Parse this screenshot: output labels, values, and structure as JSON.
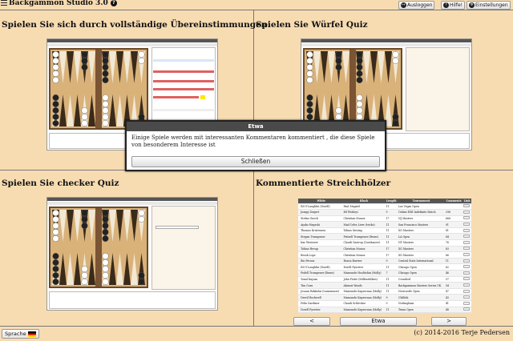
{
  "header": {
    "app_title": "Backgammon Studio 3.0",
    "buttons": [
      {
        "label": "Ausloggen",
        "icon": "logout-icon"
      },
      {
        "label": "Hilfe!",
        "icon": "help-icon"
      },
      {
        "label": "Einstellungen",
        "icon": "gear-icon"
      }
    ]
  },
  "quadrants": {
    "top_left_title": "Spielen Sie sich durch vollständige Übereinstimmungen",
    "top_right_title": "Spielen Sie Würfel Quiz",
    "bottom_left_title": "Spielen Sie checker Quiz",
    "bottom_right_title": "Kommentierte Streichhölzer"
  },
  "matches_table": {
    "headers": [
      "",
      "White",
      "Black",
      "Length",
      "Tournament",
      "Comments",
      "Link"
    ],
    "rows": [
      [
        "Ed O'Laughlin (Dorell)",
        "Paul Magriel",
        "11",
        "Las Vegas Open",
        "",
        ""
      ],
      [
        "Jumpy Ziegert",
        "Ed Wesleys",
        "9",
        "Online ESR Indefinite Match",
        "296",
        ""
      ],
      [
        "Stefan Gueck",
        "Christian Munoz",
        "17",
        "NJ Masters",
        "666",
        ""
      ],
      [
        "Ayako Hayashi",
        "Mad Celes Liver (tricks)",
        "11",
        "San Francisco Masters",
        "91",
        ""
      ],
      [
        "Thomas Kristensen",
        "Tobias Siesing",
        "11",
        "XG Masters",
        "81",
        ""
      ],
      [
        "Stepan Trumpener",
        "Fritzell Trumpener (Bears)",
        "11",
        "LA Open",
        "84",
        ""
      ],
      [
        "Kar Westover",
        "Claudi Gastrop (Quickmove)",
        "11",
        "NY Masters",
        "76",
        ""
      ],
      [
        "Tobias Hevap",
        "Christian Munoz",
        "17",
        "XG Masters",
        "83",
        ""
      ],
      [
        "Brook Lops",
        "Christian Munoz",
        "17",
        "XG Masters",
        "86",
        ""
      ],
      [
        "Bio Person",
        "Ronca Burrier",
        "9",
        "Central Stats International",
        "11",
        ""
      ],
      [
        "Ed O'Laughlin (Dorell)",
        "Dorell Pyerster",
        "11",
        "Chicago Open",
        "82",
        ""
      ],
      [
        "Fedell Trumpener (Bears)",
        "Mazounde Hoolitshin (Molly)",
        "7",
        "Chicago Open",
        "46",
        ""
      ],
      [
        "Yonal Kayam",
        "John Fisler (Millendollars)",
        "11",
        "Crossbed",
        "57",
        ""
      ],
      [
        "Tim Gora",
        "Akinori Woods",
        "11",
        "Backgammon Masters Series UK",
        "54",
        ""
      ],
      [
        "Josuan Rakkolai (Lunamouse)",
        "Mazounde Kaprovana (Molly)",
        "11",
        "Newcastle Open",
        "47",
        ""
      ],
      [
        "Drevil Rockwell",
        "Mazounde Kaprovana (Molly)",
        "9",
        "Chillick",
        "43",
        ""
      ],
      [
        "Felix Gardiner",
        "Claudi Schlecker",
        "9",
        "Nottingham",
        "41",
        ""
      ],
      [
        "Dorell Pyerster",
        "Mazounde Kaprovana (Molly)",
        "11",
        "Texas Open",
        "48",
        ""
      ]
    ]
  },
  "nav": {
    "prev": "<",
    "middle": "Etwa",
    "next": ">"
  },
  "footer": {
    "language_label": "Sprache",
    "copyright": "(c) 2014-2016 Terje Pedersen"
  },
  "modal": {
    "title": "Etwa",
    "message": "Einige Spiele werden mit interessanten Kommentaren kommentiert , die diese Spiele von besonderem Interesse ist",
    "close_label": "Schließen"
  },
  "colors": {
    "background": "#f7dcb2",
    "board": "#c9a26c",
    "modal_header": "#4a4a4a"
  }
}
